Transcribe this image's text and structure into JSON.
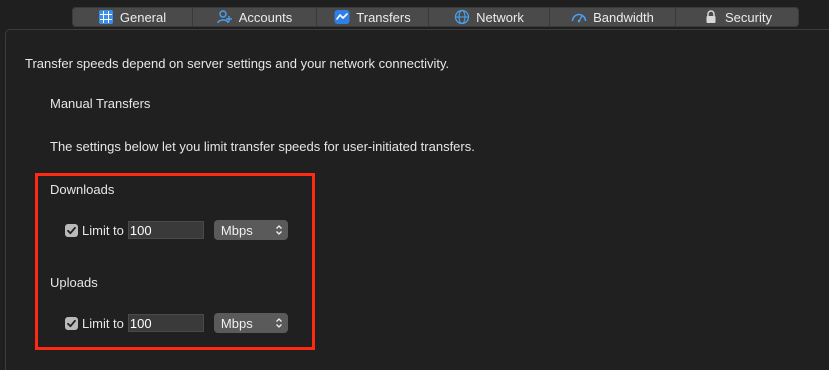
{
  "tabs": [
    {
      "label": "General",
      "icon": "general-grid-icon"
    },
    {
      "label": "Accounts",
      "icon": "accounts-icon"
    },
    {
      "label": "Transfers",
      "icon": "transfers-icon"
    },
    {
      "label": "Network",
      "icon": "globe-icon"
    },
    {
      "label": "Bandwidth",
      "icon": "speedometer-icon"
    },
    {
      "label": "Security",
      "icon": "lock-icon"
    }
  ],
  "intro_text": "Transfer speeds depend on server settings and your network connectivity.",
  "section_title": "Manual Transfers",
  "section_desc": "The settings below let you limit transfer speeds for user-initiated transfers.",
  "downloads": {
    "title": "Downloads",
    "checkbox_label": "Limit to",
    "checked": true,
    "value": "100",
    "unit": "Mbps"
  },
  "uploads": {
    "title": "Uploads",
    "checkbox_label": "Limit to",
    "checked": true,
    "value": "100",
    "unit": "Mbps"
  },
  "colors": {
    "highlight": "#ff2a12",
    "accent": "#2f7fe8"
  }
}
